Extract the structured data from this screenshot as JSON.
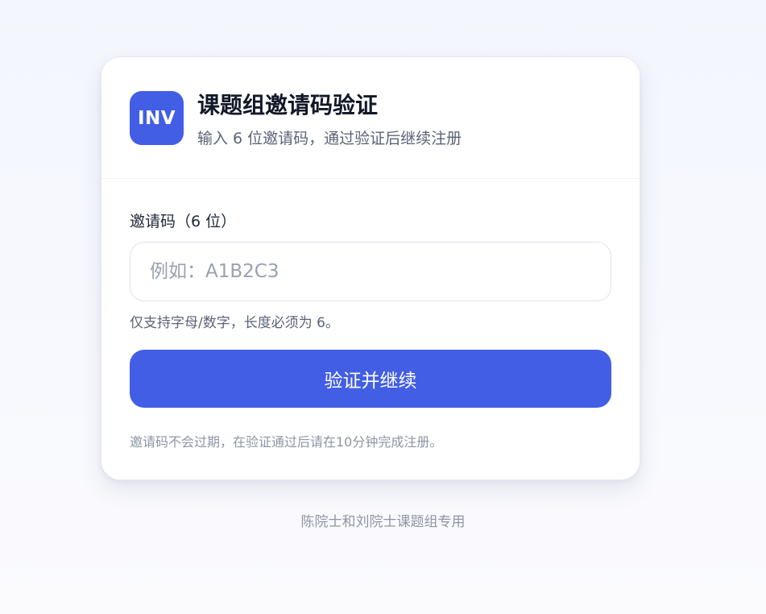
{
  "header": {
    "logo_text": "INV",
    "title": "课题组邀请码验证",
    "subtitle": "输入 6 位邀请码，通过验证后继续注册"
  },
  "form": {
    "label": "邀请码（6 位）",
    "placeholder": "例如：A1B2C3",
    "value": "",
    "hint": "仅支持字母/数字，长度必须为 6。",
    "submit_label": "验证并继续",
    "note": "邀请码不会过期，在验证通过后请在10分钟完成注册。"
  },
  "footer": {
    "text": "陈院士和刘院士课题组专用"
  },
  "colors": {
    "accent": "#425ee4",
    "background": "#f5f7fe",
    "card": "#ffffff"
  }
}
